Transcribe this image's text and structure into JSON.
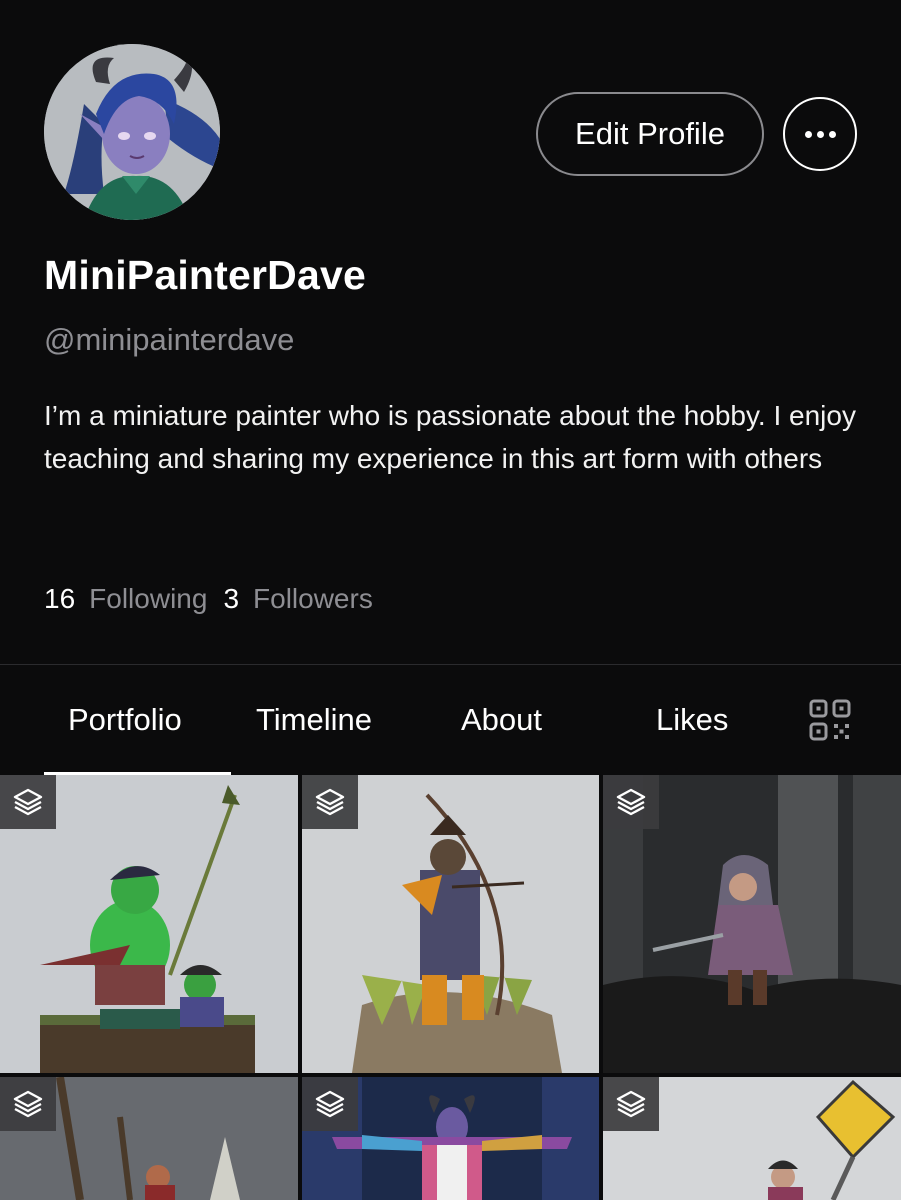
{
  "profile": {
    "display_name": "MiniPainterDave",
    "handle": "@minipainterdave",
    "bio": "I’m a miniature painter who is passionate about the hobby. I enjoy teaching and sharing my experience in this art form with others",
    "following_count": "16",
    "following_label": "Following",
    "followers_count": "3",
    "followers_label": "Followers"
  },
  "actions": {
    "edit_profile_label": "Edit Profile",
    "more_icon": "ellipsis-icon"
  },
  "tabs": [
    {
      "label": "Portfolio",
      "active": true
    },
    {
      "label": "Timeline",
      "active": false
    },
    {
      "label": "About",
      "active": false
    },
    {
      "label": "Likes",
      "active": false
    }
  ],
  "tab_extra_icon": "qr-code-icon",
  "grid": {
    "badge_icon": "layers-icon",
    "items": [
      {
        "subject": "goblin pirates miniature"
      },
      {
        "subject": "samurai archer miniature"
      },
      {
        "subject": "hooded halfling miniature"
      },
      {
        "subject": "pirate miniature"
      },
      {
        "subject": "tiefling miniature"
      },
      {
        "subject": "gnome with sign miniature"
      }
    ]
  },
  "colors": {
    "background": "#0b0b0c",
    "text_primary": "#ffffff",
    "text_secondary": "#8e8e93",
    "divider": "#2b2b2e"
  }
}
